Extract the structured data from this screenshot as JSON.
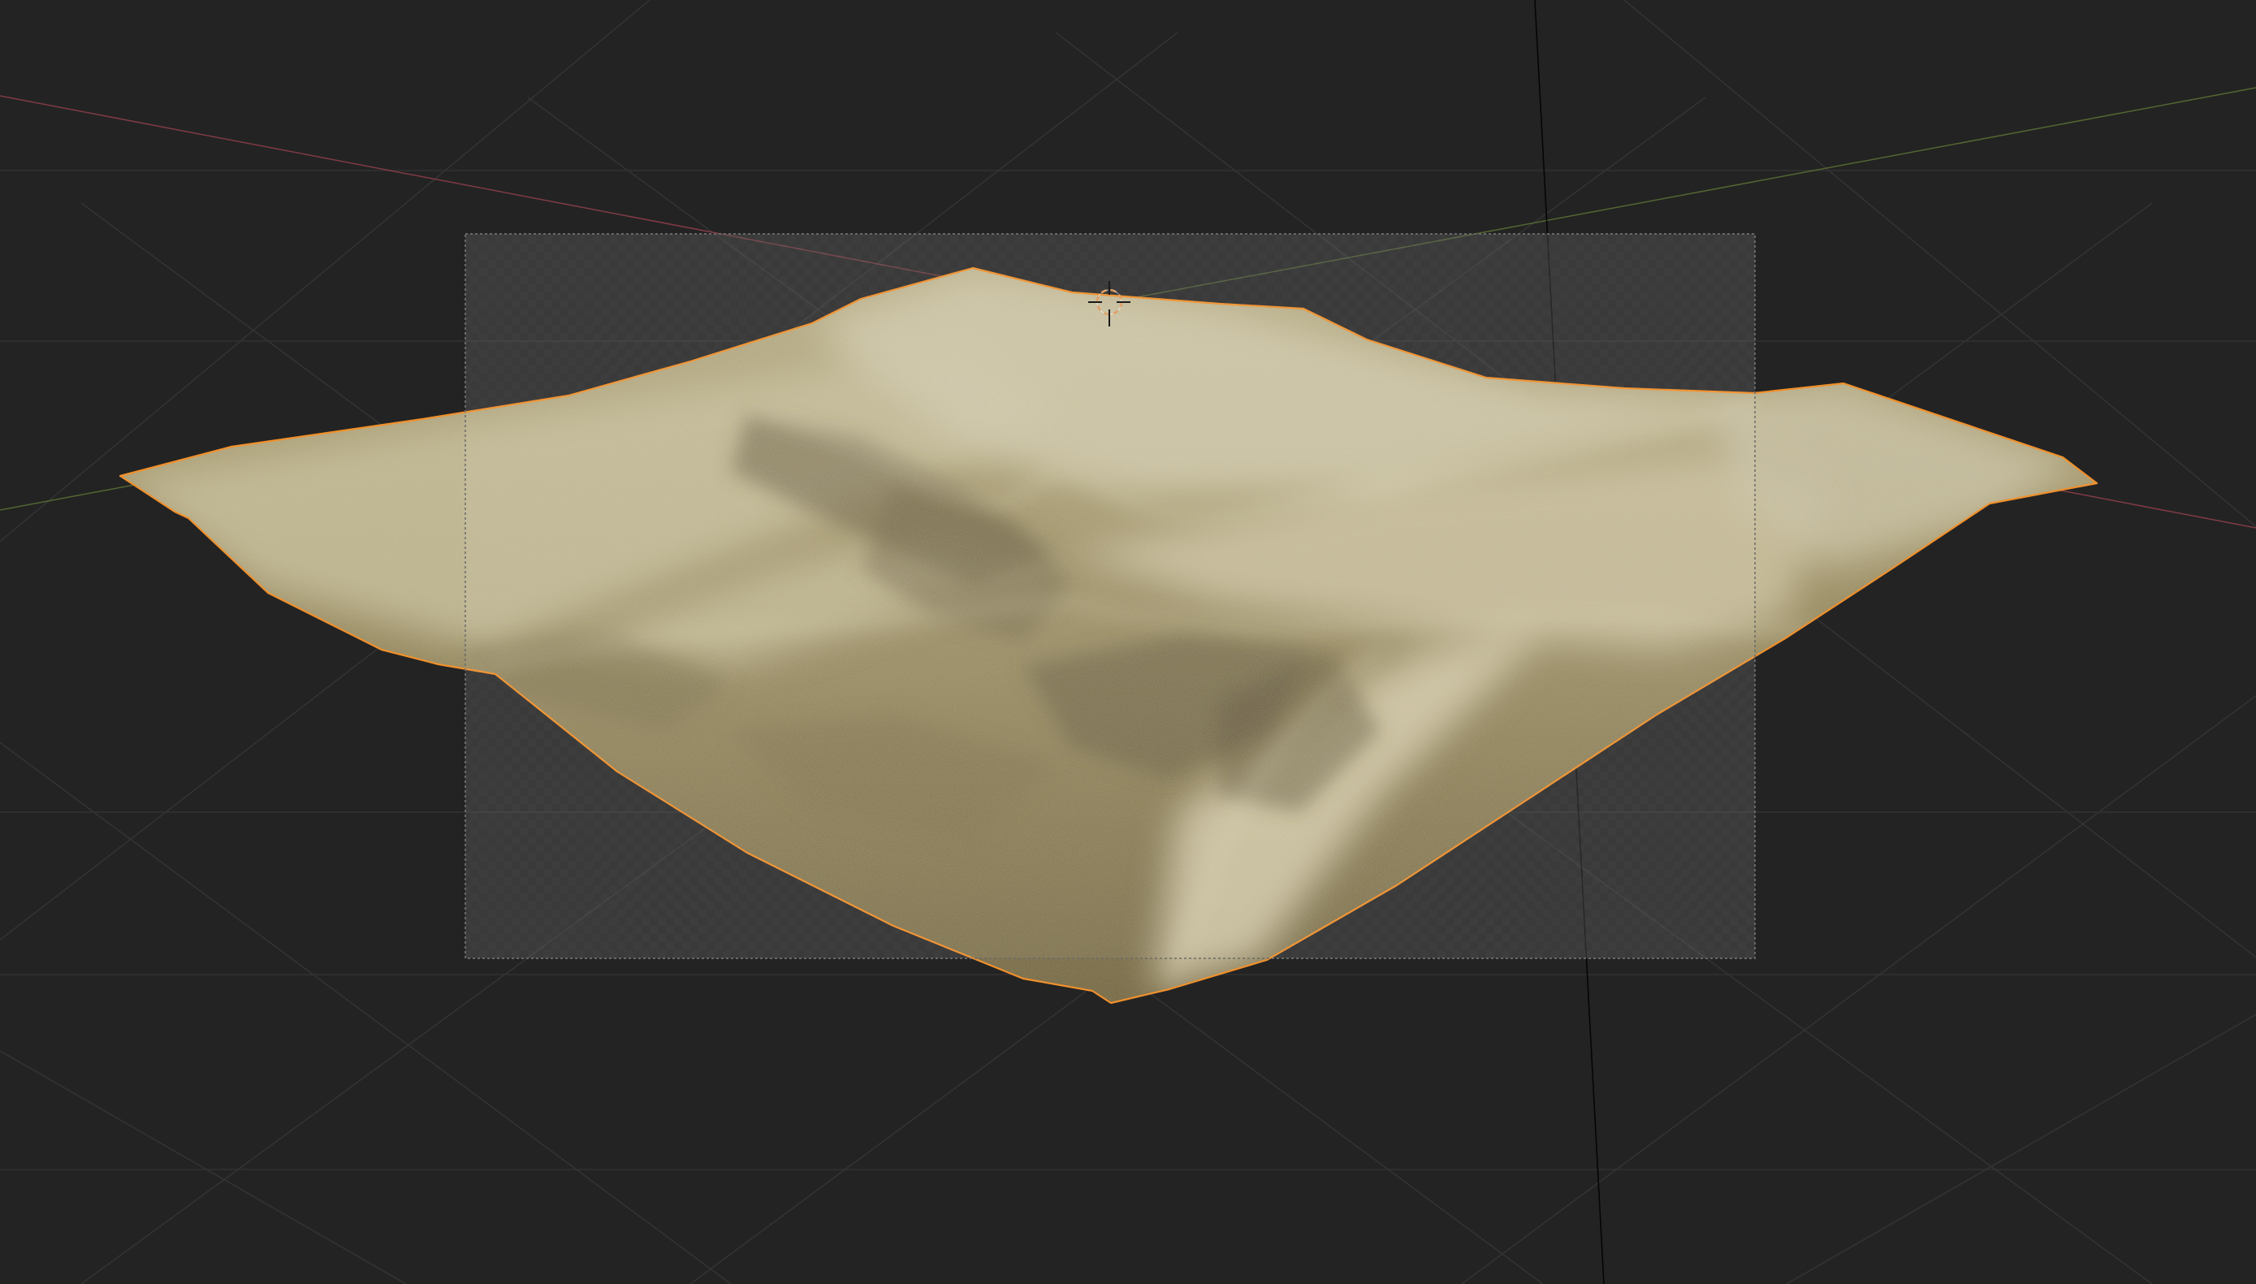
{
  "viewport": {
    "type": "3d-viewport",
    "shading": "solid",
    "background_color": "#232323"
  },
  "object": {
    "kind": "sand-dunes-terrain",
    "selected": true,
    "outline_color": "#f0902c",
    "base_color": "#8a7c4c",
    "highlight_color": "#cdc4a6"
  },
  "camera_frame": {
    "visible": true
  },
  "axes": {
    "x_color": "#a04350",
    "y_color": "#647d37",
    "z_color": "#000000"
  },
  "cursor": {
    "icon": "3d-cursor-icon",
    "color": "#e0a066"
  },
  "grid": {
    "visible": true,
    "color": "#333333"
  }
}
